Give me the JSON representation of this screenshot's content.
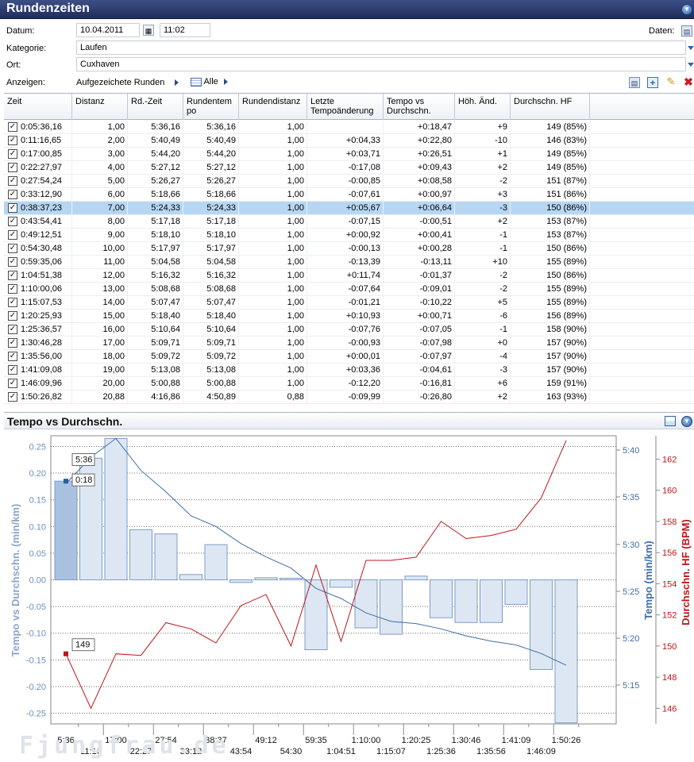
{
  "window": {
    "title": "Rundenzeiten"
  },
  "form": {
    "datum_label": "Datum:",
    "datum_value": "10.04.2011",
    "time_value": "11:02",
    "daten_label": "Daten:",
    "kategorie_label": "Kategorie:",
    "kategorie_value": "Laufen",
    "ort_label": "Ort:",
    "ort_value": "Cuxhaven",
    "anzeigen_label": "Anzeigen:",
    "anzeigen_value": "Aufgezeichete Runden",
    "alle_label": "Alle"
  },
  "grid": {
    "columns": [
      "Zeit",
      "Distanz",
      "Rd.-Zeit",
      "Rundentem po",
      "Rundendistanz",
      "Letzte Tempoänderung",
      "Tempo vs Durchschn.",
      "Höh. Änd.",
      "Durchschn. HF"
    ],
    "selected_row": 6,
    "rows": [
      [
        "0:05:36,16",
        "1,00",
        "5:36,16",
        "5:36,16",
        "1,00",
        "",
        "+0:18,47",
        "+9",
        "149 (85%)"
      ],
      [
        "0:11:16,65",
        "2,00",
        "5:40,49",
        "5:40,49",
        "1,00",
        "+0:04,33",
        "+0:22,80",
        "-10",
        "146 (83%)"
      ],
      [
        "0:17:00,85",
        "3,00",
        "5:44,20",
        "5:44,20",
        "1,00",
        "+0:03,71",
        "+0:26,51",
        "+1",
        "149 (85%)"
      ],
      [
        "0:22:27,97",
        "4,00",
        "5:27,12",
        "5:27,12",
        "1,00",
        "-0:17,08",
        "+0:09,43",
        "+2",
        "149 (85%)"
      ],
      [
        "0:27:54,24",
        "5,00",
        "5:26,27",
        "5:26,27",
        "1,00",
        "-0:00,85",
        "+0:08,58",
        "-2",
        "151 (87%)"
      ],
      [
        "0:33:12,90",
        "6,00",
        "5:18,66",
        "5:18,66",
        "1,00",
        "-0:07,61",
        "+0:00,97",
        "+3",
        "151 (86%)"
      ],
      [
        "0:38:37,23",
        "7,00",
        "5:24,33",
        "5:24,33",
        "1,00",
        "+0:05,67",
        "+0:06,64",
        "-3",
        "150 (86%)"
      ],
      [
        "0:43:54,41",
        "8,00",
        "5:17,18",
        "5:17,18",
        "1,00",
        "-0:07,15",
        "-0:00,51",
        "+2",
        "153 (87%)"
      ],
      [
        "0:49:12,51",
        "9,00",
        "5:18,10",
        "5:18,10",
        "1,00",
        "+0:00,92",
        "+0:00,41",
        "-1",
        "153 (87%)"
      ],
      [
        "0:54:30,48",
        "10,00",
        "5:17,97",
        "5:17,97",
        "1,00",
        "-0:00,13",
        "+0:00,28",
        "-1",
        "150 (86%)"
      ],
      [
        "0:59:35,06",
        "11,00",
        "5:04,58",
        "5:04,58",
        "1,00",
        "-0:13,39",
        "-0:13,11",
        "+10",
        "155 (89%)"
      ],
      [
        "1:04:51,38",
        "12,00",
        "5:16,32",
        "5:16,32",
        "1,00",
        "+0:11,74",
        "-0:01,37",
        "-2",
        "150 (86%)"
      ],
      [
        "1:10:00,06",
        "13,00",
        "5:08,68",
        "5:08,68",
        "1,00",
        "-0:07,64",
        "-0:09,01",
        "-2",
        "155 (89%)"
      ],
      [
        "1:15:07,53",
        "14,00",
        "5:07,47",
        "5:07,47",
        "1,00",
        "-0:01,21",
        "-0:10,22",
        "+5",
        "155 (89%)"
      ],
      [
        "1:20:25,93",
        "15,00",
        "5:18,40",
        "5:18,40",
        "1,00",
        "+0:10,93",
        "+0:00,71",
        "-6",
        "156 (89%)"
      ],
      [
        "1:25:36,57",
        "16,00",
        "5:10,64",
        "5:10,64",
        "1,00",
        "-0:07,76",
        "-0:07,05",
        "-1",
        "158 (90%)"
      ],
      [
        "1:30:46,28",
        "17,00",
        "5:09,71",
        "5:09,71",
        "1,00",
        "-0:00,93",
        "-0:07,98",
        "+0",
        "157 (90%)"
      ],
      [
        "1:35:56,00",
        "18,00",
        "5:09,72",
        "5:09,72",
        "1,00",
        "+0:00,01",
        "-0:07,97",
        "-4",
        "157 (90%)"
      ],
      [
        "1:41:09,08",
        "19,00",
        "5:13,08",
        "5:13,08",
        "1,00",
        "+0:03,36",
        "-0:04,61",
        "-3",
        "157 (90%)"
      ],
      [
        "1:46:09,96",
        "20,00",
        "5:00,88",
        "5:00,88",
        "1,00",
        "-0:12,20",
        "-0:16,81",
        "+6",
        "159 (91%)"
      ],
      [
        "1:50:26,82",
        "20,88",
        "4:16,86",
        "4:50,89",
        "0,88",
        "-0:09,99",
        "-0:26,80",
        "+2",
        "163 (93%)"
      ]
    ]
  },
  "chart_panel": {
    "title": "Tempo vs Durchschn."
  },
  "chart_data": {
    "type": "bar",
    "title": "",
    "x_tick_labels": [
      "5:36",
      "11:16",
      "17:00",
      "22:27",
      "27:54",
      "33:12",
      "38:37",
      "43:54",
      "49:12",
      "54:30",
      "59:35",
      "1:04:51",
      "1:10:00",
      "1:15:07",
      "1:20:25",
      "1:25:36",
      "1:30:46",
      "1:35:56",
      "1:41:09",
      "1:46:09",
      "1:50:26"
    ],
    "left_axis": {
      "label": "Tempo vs Durchschn. (min/km)",
      "ylim": [
        -0.27,
        0.27
      ],
      "ticks": [
        "0.25",
        "0.20",
        "0.15",
        "0.10",
        "0.05",
        "0.00",
        "-0.05",
        "-0.10",
        "-0.15",
        "-0.20",
        "-0.25"
      ]
    },
    "right_axis_1": {
      "label": "Tempo (min/km)",
      "ticks": [
        "5:40",
        "5:35",
        "5:30",
        "5:25",
        "5:20",
        "5:15"
      ]
    },
    "right_axis_2": {
      "label": "Durchschn. HF (BPM)",
      "ylim": [
        145,
        163.5
      ],
      "ticks": [
        "162",
        "160",
        "158",
        "156",
        "154",
        "152",
        "150",
        "148",
        "146"
      ]
    },
    "series": [
      {
        "name": "Tempo vs Durchschn. (min/km)",
        "type": "bar",
        "values": [
          0.185,
          0.228,
          0.265,
          0.094,
          0.086,
          0.01,
          0.066,
          -0.005,
          0.004,
          0.003,
          -0.131,
          -0.014,
          -0.09,
          -0.102,
          0.007,
          -0.071,
          -0.08,
          -0.08,
          -0.046,
          -0.168,
          -0.268
        ]
      },
      {
        "name": "Tempo (min/km)",
        "type": "line",
        "values": [
          0.18,
          0.23,
          0.265,
          0.205,
          0.165,
          0.12,
          0.1,
          0.068,
          0.043,
          0.022,
          -0.016,
          -0.035,
          -0.062,
          -0.078,
          -0.082,
          -0.092,
          -0.105,
          -0.115,
          -0.122,
          -0.138,
          -0.16
        ]
      },
      {
        "name": "Durchschn. HF (BPM)",
        "type": "line",
        "values": [
          149.5,
          146,
          149.5,
          149.4,
          151.5,
          151.1,
          150.2,
          152.6,
          153.3,
          150,
          155.2,
          150.3,
          155.5,
          155.5,
          155.7,
          158,
          156.9,
          157.1,
          157.5,
          159.5,
          163.2
        ]
      }
    ],
    "annotations": [
      {
        "label": "5:36"
      },
      {
        "label": "0:18"
      },
      {
        "label": "149"
      }
    ],
    "watermark": "Fjungfrau.de"
  }
}
